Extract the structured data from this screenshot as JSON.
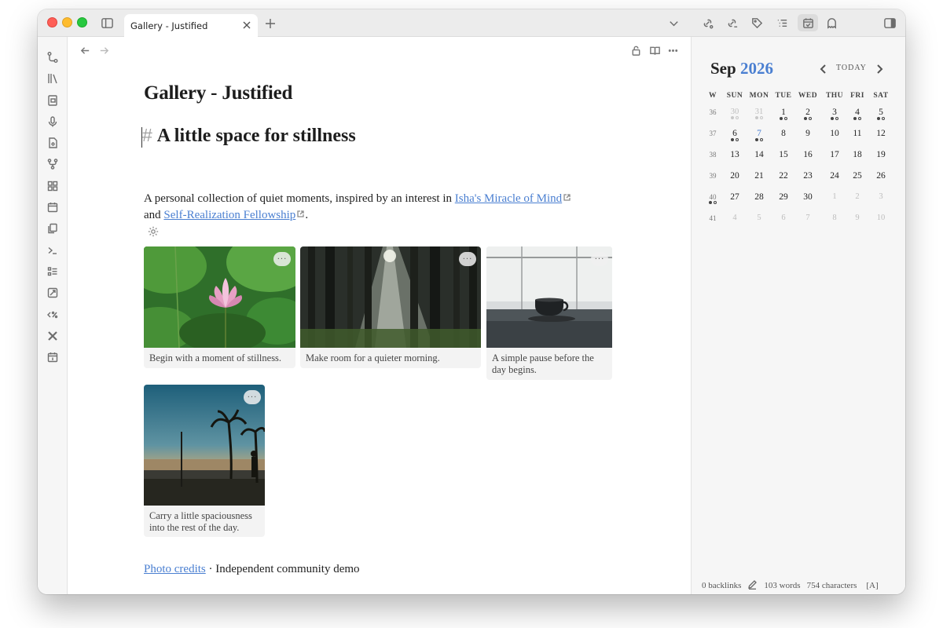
{
  "tab": {
    "title": "Gallery - Justified"
  },
  "note": {
    "title": "Gallery - Justified",
    "heading_hash": "#",
    "heading": "A little space for stillness",
    "para": {
      "text1": "A personal collection of quiet moments, inspired by an interest in ",
      "link1": "Isha's Miracle of Mind",
      "text2": "and ",
      "link2": "Self-Realization Fellowship",
      "text3": "."
    },
    "cards": [
      {
        "caption": "Begin with a moment of stillness.",
        "image": "lotus-flower",
        "more": "···"
      },
      {
        "caption": "Make room for a quieter morning.",
        "image": "sunlit-forest",
        "more": "···"
      },
      {
        "caption_line1": "A simple pause before the",
        "caption_line2": "day begins.",
        "image": "coffee-cup",
        "more": "···"
      },
      {
        "caption_line1": "Carry a little spaciousness",
        "caption_line2": "into the rest of the day.",
        "image": "beach-sunset-palms",
        "more": "···"
      }
    ],
    "credits_link": "Photo credits",
    "credits_text": " · Independent community demo"
  },
  "calendar": {
    "month": "Sep",
    "year": "2026",
    "today_label": "TODAY",
    "dow": [
      "W",
      "SUN",
      "MON",
      "TUE",
      "WED",
      "THU",
      "FRI",
      "SAT"
    ],
    "weeks": [
      {
        "w": "36",
        "days": [
          "30",
          "31",
          "1",
          "2",
          "3",
          "4",
          "5"
        ]
      },
      {
        "w": "37",
        "days": [
          "6",
          "7",
          "8",
          "9",
          "10",
          "11",
          "12"
        ]
      },
      {
        "w": "38",
        "days": [
          "13",
          "14",
          "15",
          "16",
          "17",
          "18",
          "19"
        ]
      },
      {
        "w": "39",
        "days": [
          "20",
          "21",
          "22",
          "23",
          "24",
          "25",
          "26"
        ]
      },
      {
        "w": "40",
        "days": [
          "27",
          "28",
          "29",
          "30",
          "1",
          "2",
          "3"
        ]
      },
      {
        "w": "41",
        "days": [
          "4",
          "5",
          "6",
          "7",
          "8",
          "9",
          "10"
        ]
      }
    ]
  },
  "status": {
    "backlinks": "0 backlinks",
    "words": "103 words",
    "characters": "754 characters",
    "mode": "[A]"
  }
}
